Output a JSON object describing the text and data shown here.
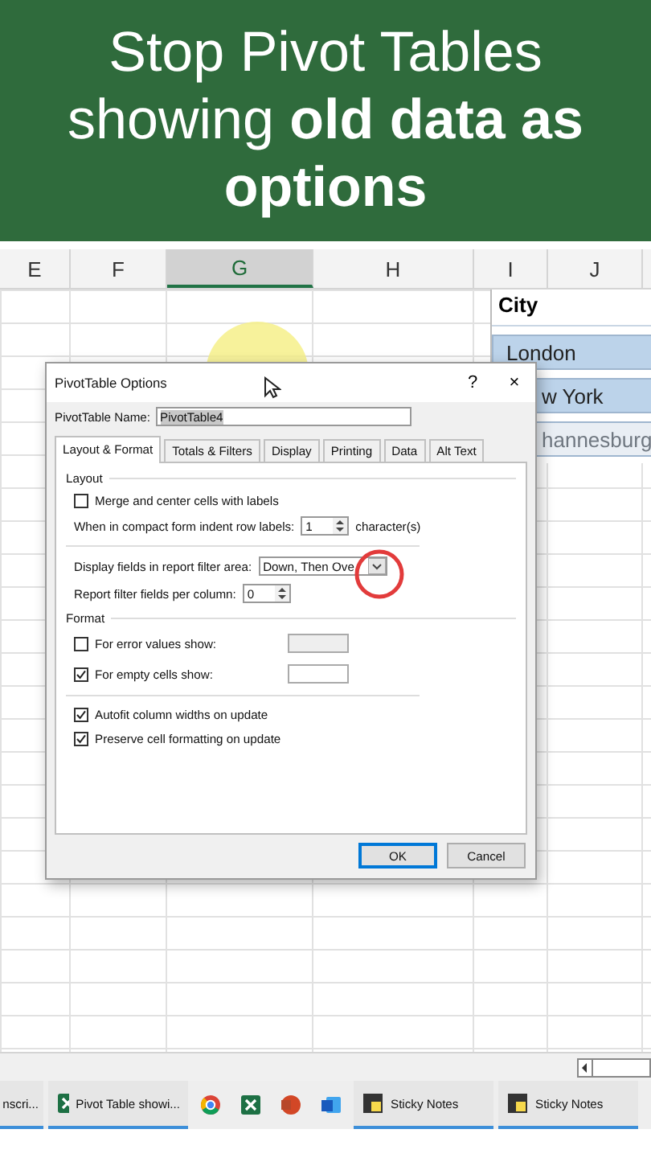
{
  "banner": {
    "lines": [
      "Stop Pivot Tables",
      "showing **old data as**",
      "**options**"
    ]
  },
  "sheet": {
    "columns": [
      {
        "label": "E",
        "selected": false
      },
      {
        "label": "F",
        "selected": false
      },
      {
        "label": "G",
        "selected": true
      },
      {
        "label": "H",
        "selected": false
      },
      {
        "label": "I",
        "selected": false
      },
      {
        "label": "J",
        "selected": false
      }
    ]
  },
  "slicer": {
    "title": "City",
    "items": [
      {
        "label": "London",
        "selected": true,
        "cut": false
      },
      {
        "label": "w York",
        "selected": true,
        "cut": true
      },
      {
        "label": "hannesburg",
        "selected": false,
        "cut": true
      }
    ]
  },
  "dialog": {
    "title": "PivotTable Options",
    "help": "?",
    "close": "×",
    "name_label": "PivotTable Name:",
    "name_value": "PivotTable4",
    "tabs": [
      {
        "label": "Layout & Format",
        "selected": true
      },
      {
        "label": "Totals & Filters",
        "selected": false
      },
      {
        "label": "Display",
        "selected": false
      },
      {
        "label": "Printing",
        "selected": false
      },
      {
        "label": "Data",
        "selected": false
      },
      {
        "label": "Alt Text",
        "selected": false
      }
    ],
    "sections": [
      {
        "title": "Layout",
        "rows": [
          {
            "kind": "checkbox",
            "label": "Merge and center cells with labels",
            "checked": false
          },
          {
            "kind": "spinner",
            "label": "When in compact form indent row labels:",
            "value": "1",
            "suffix": "character(s)"
          },
          {
            "kind": "divider"
          },
          {
            "kind": "dropdown",
            "label": "Display fields in report filter area:",
            "value": "Down, Then Ove"
          },
          {
            "kind": "spinner",
            "label": "Report filter fields per column:",
            "value": "0"
          }
        ]
      },
      {
        "title": "Format",
        "rows": [
          {
            "kind": "checkfield",
            "label": "For error values show:",
            "checked": false
          },
          {
            "kind": "checkfield",
            "label": "For empty cells show:",
            "checked": true
          },
          {
            "kind": "divider"
          },
          {
            "kind": "checkbox",
            "label": "Autofit column widths on update",
            "checked": true
          },
          {
            "kind": "checkbox",
            "label": "Preserve cell formatting on update",
            "checked": true
          }
        ]
      }
    ],
    "buttons": [
      {
        "label": "OK",
        "default": true
      },
      {
        "label": "Cancel",
        "default": false
      }
    ]
  },
  "taskbar": {
    "items": [
      {
        "kind": "plain",
        "label": "nscri..."
      },
      {
        "kind": "excel",
        "label": "Pivot Table showi..."
      },
      {
        "kind": "chrome"
      },
      {
        "kind": "excel"
      },
      {
        "kind": "powerpoint"
      },
      {
        "kind": "word"
      },
      {
        "kind": "sticky",
        "label": "Sticky Notes"
      },
      {
        "kind": "sticky",
        "label": "Sticky Notes"
      }
    ]
  }
}
